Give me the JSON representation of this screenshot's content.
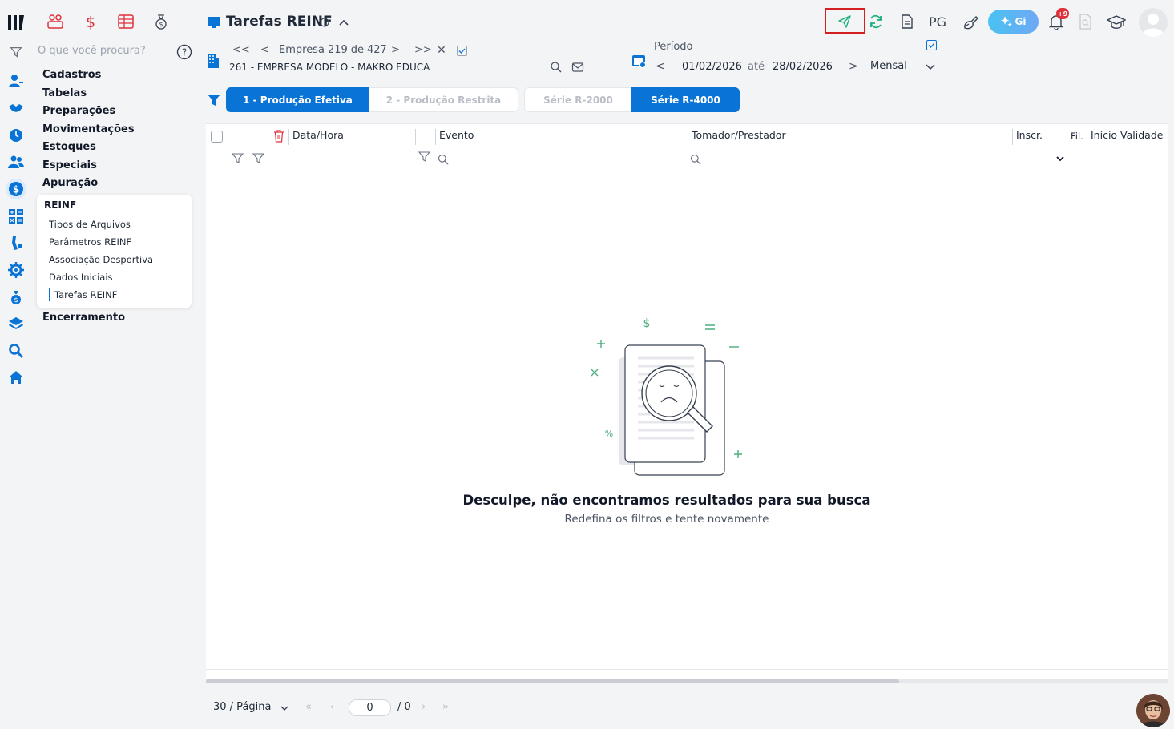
{
  "header": {
    "title": "Tarefas REINF",
    "pg_label": "PG",
    "gi_label": "Gi",
    "notification_count": "+9"
  },
  "search": {
    "placeholder": "O que você procura?"
  },
  "sidebar": {
    "menu": [
      "Cadastros",
      "Tabelas",
      "Preparações",
      "Movimentações",
      "Estoques",
      "Especiais",
      "Apuração"
    ],
    "submenu_title": "REINF",
    "submenu": [
      "Tipos de Arquivos",
      "Parâmetros REINF",
      "Associação Desportiva",
      "Dados Iniciais",
      "Tarefas REINF"
    ],
    "after": "Encerramento"
  },
  "company": {
    "nav_label": "Empresa",
    "nav_current": "219",
    "nav_of": "de",
    "nav_total": "427",
    "name": "261 - EMPRESA MODELO - MAKRO EDUCA"
  },
  "period": {
    "label": "Período",
    "start": "01/02/2026",
    "to": "até",
    "end": "28/02/2026",
    "mode": "Mensal"
  },
  "tabs": {
    "production": [
      "1 - Produção Efetiva",
      "2 - Produção Restrita"
    ],
    "series": [
      "Série R-2000",
      "Série R-4000"
    ]
  },
  "table": {
    "columns": [
      "Data/Hora",
      "Evento",
      "Tomador/Prestador",
      "Inscr.",
      "Fil.",
      "Início Validade"
    ]
  },
  "empty": {
    "title": "Desculpe, não encontramos resultados para sua busca",
    "subtitle": "Redefina os filtros e tente novamente"
  },
  "pagination": {
    "per_page": "30 / Página",
    "page": "0",
    "total": "/ 0"
  },
  "colors": {
    "primary": "#0a74d6",
    "accent_red": "#e0303a",
    "highlight_box": "#d42020",
    "gi_gradient_start": "#49c2f2",
    "gi_gradient_end": "#6fa8f5"
  }
}
